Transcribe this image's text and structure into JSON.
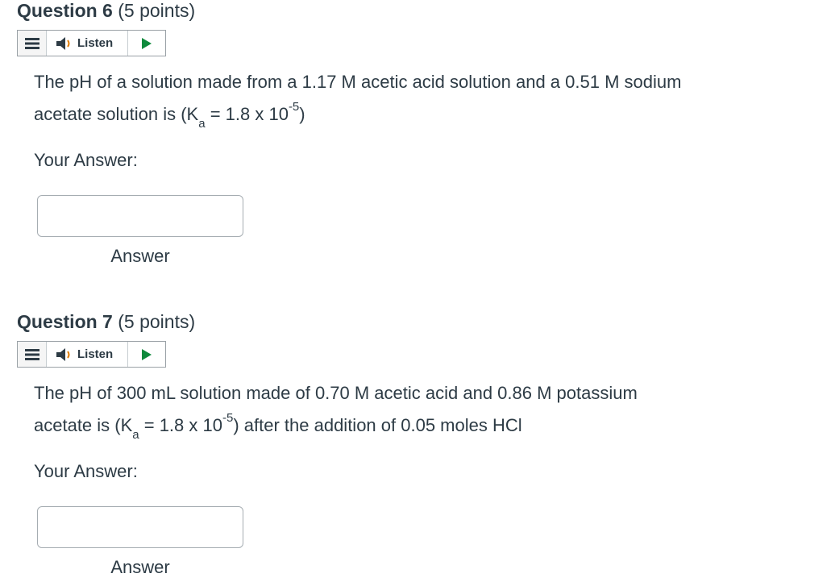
{
  "questions": [
    {
      "title": "Question 6",
      "points": "(5 points)",
      "listen_label": "Listen",
      "text_line1": "The pH of a solution made from a 1.17 M acetic acid solution and a 0.51 M sodium",
      "text_line2_pre": "acetate solution is (K",
      "text_sub": "a",
      "text_mid": " = 1.8 x 10",
      "text_sup": "-5",
      "text_post": ")",
      "your_answer_label": "Your Answer:",
      "answer_value": "",
      "answer_caption": "Answer"
    },
    {
      "title": "Question 7",
      "points": "(5 points)",
      "listen_label": "Listen",
      "text_line1": "The pH of 300 mL solution made of 0.70 M acetic acid and 0.86 M potassium",
      "text_line2_pre": "acetate is (K",
      "text_sub": "a",
      "text_mid": " = 1.8 x 10",
      "text_sup": "-5",
      "text_post": ") after the addition of 0.05 moles HCl",
      "your_answer_label": "Your Answer:",
      "answer_value": "",
      "answer_caption": "Answer"
    }
  ],
  "icons": {
    "menu": "menu-icon",
    "speaker": "speaker-icon",
    "play": "play-icon"
  },
  "colors": {
    "text": "#2d3b45",
    "play": "#0f8a3c",
    "border": "#9aa1a6"
  }
}
